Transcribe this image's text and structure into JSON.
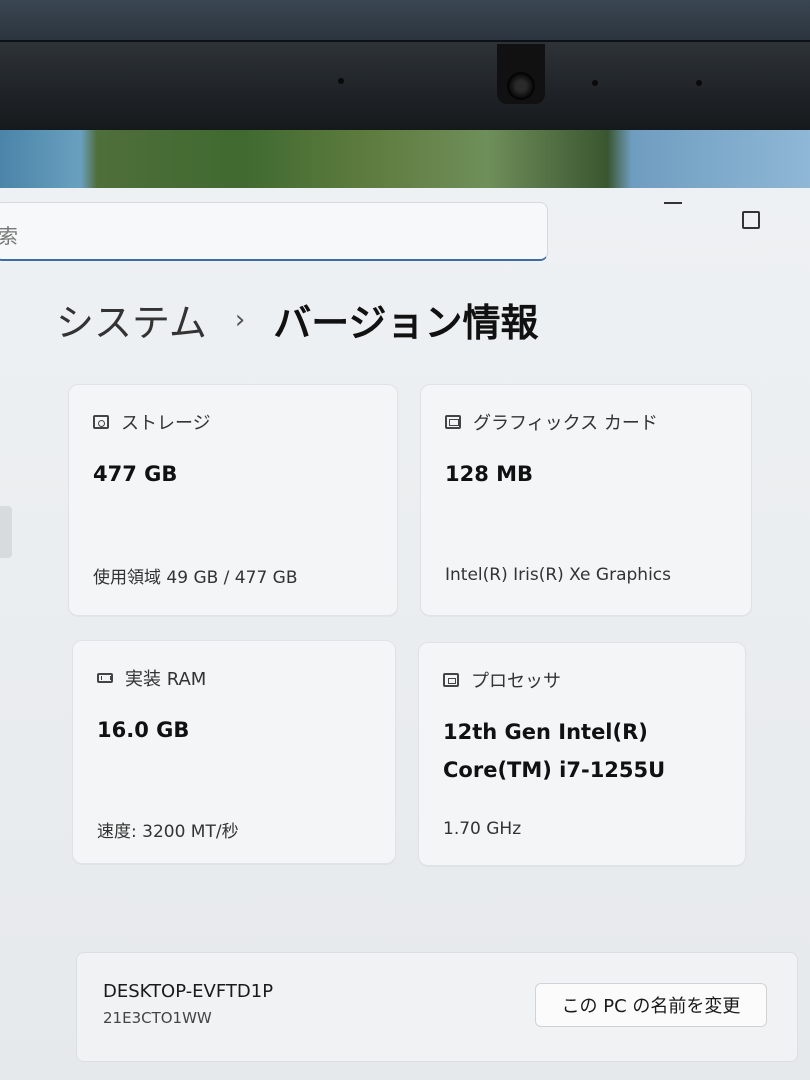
{
  "breadcrumb": {
    "parent": "システム",
    "separator": "›",
    "current": "バージョン情報"
  },
  "cards": {
    "storage": {
      "label": "ストレージ",
      "value": "477 GB",
      "detail": "使用領域 49 GB / 477 GB"
    },
    "graphics": {
      "label": "グラフィックス カード",
      "value": "128 MB",
      "detail": "Intel(R) Iris(R) Xe Graphics"
    },
    "ram": {
      "label": "実装 RAM",
      "value": "16.0 GB",
      "detail": "速度: 3200 MT/秒"
    },
    "processor": {
      "label": "プロセッサ",
      "value_line1": "12th Gen Intel(R)",
      "value_line2": "Core(TM) i7-1255U",
      "detail": "1.70 GHz"
    }
  },
  "device": {
    "name": "DESKTOP-EVFTD1P",
    "model": "21E3CTO1WW",
    "rename_button": "この PC の名前を変更"
  },
  "icons": [
    "storage-icon",
    "graphics-card-icon",
    "ram-icon",
    "processor-icon",
    "webcam-icon"
  ]
}
